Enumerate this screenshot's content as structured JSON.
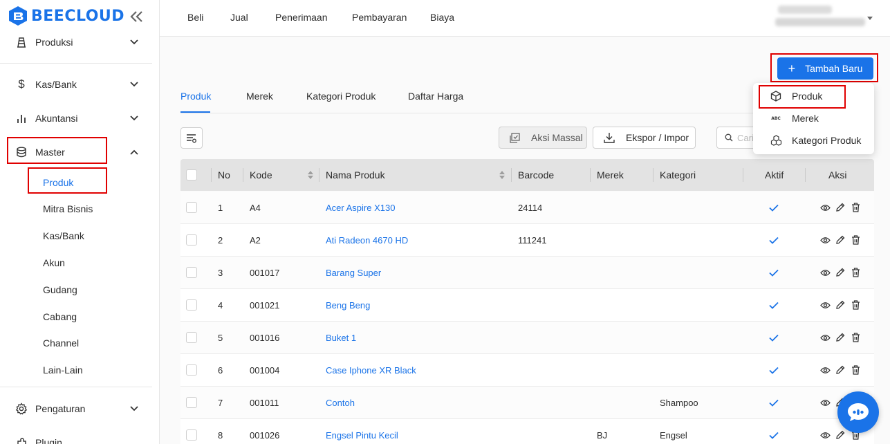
{
  "app": {
    "brand": "BEECLOUD"
  },
  "sidebar": {
    "items": [
      {
        "label": "Produksi",
        "icon": "factory-icon"
      },
      {
        "label": "Kas/Bank",
        "icon": "dollar-icon"
      },
      {
        "label": "Akuntansi",
        "icon": "bar-chart-icon"
      },
      {
        "label": "Master",
        "icon": "database-icon",
        "expanded": true
      },
      {
        "label": "Pengaturan",
        "icon": "gear-icon"
      },
      {
        "label": "Plugin",
        "icon": "plugin-icon"
      }
    ],
    "master_sub": [
      "Produk",
      "Mitra Bisnis",
      "Kas/Bank",
      "Akun",
      "Gudang",
      "Cabang",
      "Channel",
      "Lain-Lain"
    ],
    "active_sub": "Produk"
  },
  "topnav": [
    "Beli",
    "Jual",
    "Penerimaan",
    "Pembayaran",
    "Biaya"
  ],
  "main": {
    "add_button": "Tambah Baru",
    "tabs": [
      "Produk",
      "Merek",
      "Kategori Produk",
      "Daftar Harga"
    ],
    "active_tab": "Produk",
    "mass_action": "Aksi Massal",
    "export_import": "Ekspor / Impor",
    "search_placeholder": "Cari"
  },
  "dropdown": [
    {
      "label": "Produk",
      "icon": "cube-icon"
    },
    {
      "label": "Merek",
      "icon": "abc-icon"
    },
    {
      "label": "Kategori Produk",
      "icon": "cubes-icon"
    }
  ],
  "table": {
    "columns": [
      "No",
      "Kode",
      "Nama Produk",
      "Barcode",
      "Merek",
      "Kategori",
      "Aktif",
      "Aksi"
    ],
    "rows": [
      {
        "no": "1",
        "kode": "A4",
        "nama": "Acer Aspire X130",
        "barcode": "24114",
        "merek": "",
        "kategori": "",
        "aktif": true
      },
      {
        "no": "2",
        "kode": "A2",
        "nama": "Ati Radeon 4670 HD",
        "barcode": "111241",
        "merek": "",
        "kategori": "",
        "aktif": true
      },
      {
        "no": "3",
        "kode": "001017",
        "nama": "Barang Super",
        "barcode": "",
        "merek": "",
        "kategori": "",
        "aktif": true
      },
      {
        "no": "4",
        "kode": "001021",
        "nama": "Beng Beng",
        "barcode": "",
        "merek": "",
        "kategori": "",
        "aktif": true
      },
      {
        "no": "5",
        "kode": "001016",
        "nama": "Buket 1",
        "barcode": "",
        "merek": "",
        "kategori": "",
        "aktif": true
      },
      {
        "no": "6",
        "kode": "001004",
        "nama": "Case Iphone XR Black",
        "barcode": "",
        "merek": "",
        "kategori": "",
        "aktif": true
      },
      {
        "no": "7",
        "kode": "001011",
        "nama": "Contoh",
        "barcode": "",
        "merek": "",
        "kategori": "Shampoo",
        "aktif": true
      },
      {
        "no": "8",
        "kode": "001026",
        "nama": "Engsel Pintu Kecil",
        "barcode": "",
        "merek": "BJ",
        "kategori": "Engsel",
        "aktif": true
      }
    ]
  },
  "colors": {
    "accent": "#1a73e8",
    "highlight": "#e00000"
  }
}
